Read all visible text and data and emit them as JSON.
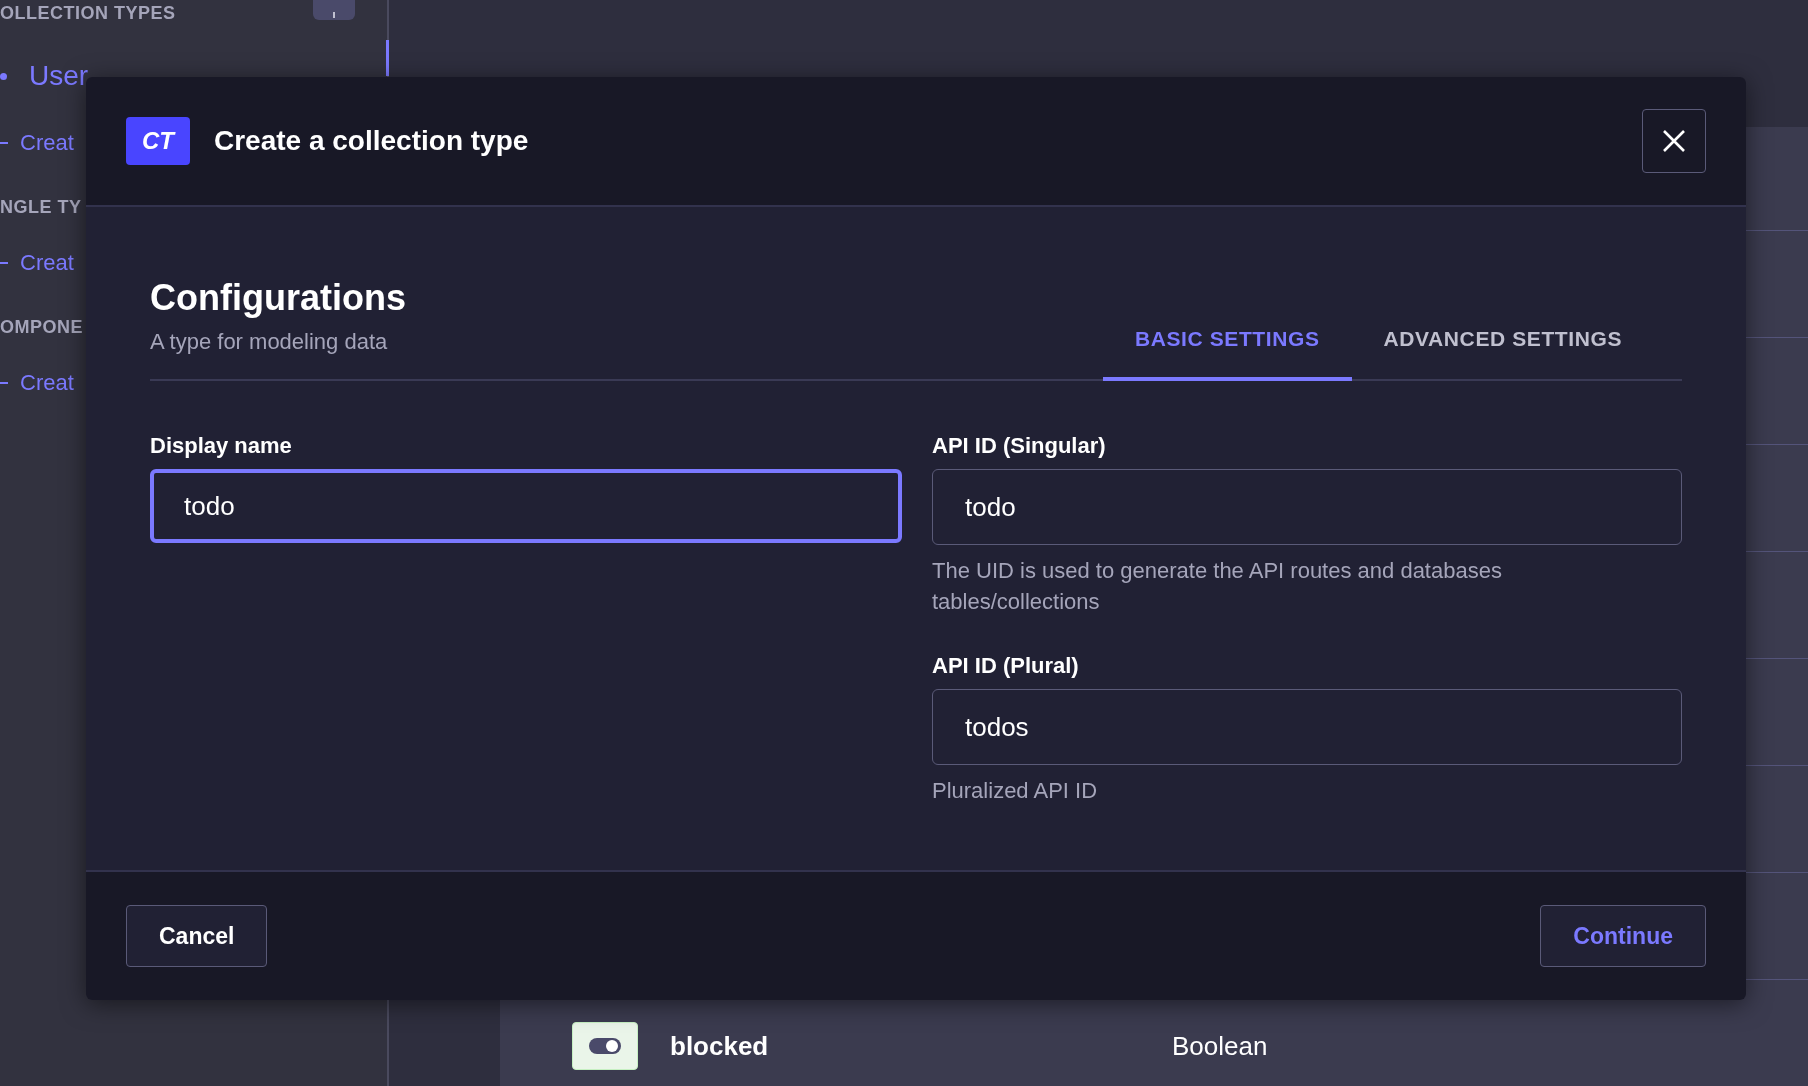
{
  "sidebar": {
    "sections": [
      {
        "heading": "OLLECTION TYPES",
        "items": [
          {
            "label": "User",
            "kind": "entry"
          },
          {
            "label": "Creat",
            "kind": "create"
          }
        ]
      },
      {
        "heading": "NGLE TY",
        "items": [
          {
            "label": "Creat",
            "kind": "create"
          }
        ]
      },
      {
        "heading": "OMPONE",
        "items": [
          {
            "label": "Creat",
            "kind": "create"
          }
        ]
      }
    ]
  },
  "background_table": {
    "rows": [
      {
        "name": "blocked",
        "type": "Boolean",
        "kind": "boolean"
      }
    ]
  },
  "modal": {
    "badge": "CT",
    "title": "Create a collection type",
    "heading": "Configurations",
    "subtitle": "A type for modeling data",
    "tabs": [
      {
        "label": "BASIC SETTINGS",
        "selected": true
      },
      {
        "label": "ADVANCED SETTINGS",
        "selected": false
      }
    ],
    "left_fields": [
      {
        "label": "Display name",
        "value": "todo",
        "focused": true
      }
    ],
    "right_fields": [
      {
        "label": "API ID (Singular)",
        "value": "todo",
        "focused": false,
        "hint": "The UID is used to generate the API routes and databases tables/collections"
      },
      {
        "label": "API ID (Plural)",
        "value": "todos",
        "focused": false,
        "hint": "Pluralized API ID"
      }
    ],
    "buttons": [
      {
        "label": "Cancel",
        "kind": "secondary"
      },
      {
        "label": "Continue",
        "kind": "primary"
      }
    ]
  }
}
